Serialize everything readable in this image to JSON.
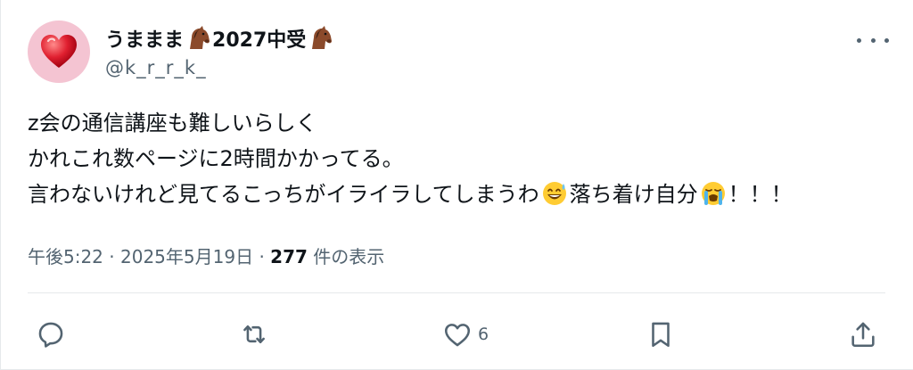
{
  "tweet": {
    "display_name": "うままま",
    "display_name_suffix": "2027中受",
    "handle": "@k_r_r_k_",
    "lines": [
      {
        "text": "z会の通信講座も難しいらしく"
      },
      {
        "text": "かれこれ数ページに2時間かかってる。"
      },
      {
        "a": "言わないけれど見てるこっちがイライラしてしまうわ",
        "b": "落ち着け自分",
        "c": "！！！"
      }
    ],
    "time": "午後5:22",
    "separator": "·",
    "date": "2025年5月19日",
    "views_count": "277",
    "views_label": "件の表示"
  },
  "actions": {
    "reply_icon": "reply-icon",
    "retweet_icon": "retweet-icon",
    "like_icon": "heart-icon",
    "like_count": "6",
    "bookmark_icon": "bookmark-icon",
    "share_icon": "share-icon"
  },
  "colors": {
    "text": "#0f1419",
    "secondary": "#536471",
    "avatar_bg": "#f4c4d2",
    "heart_red": "#e0245e"
  }
}
